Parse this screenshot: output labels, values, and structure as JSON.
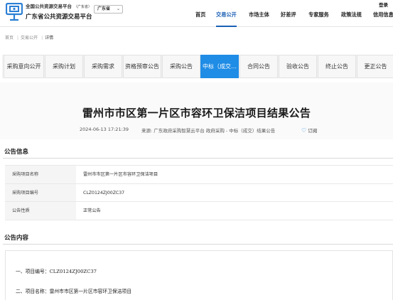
{
  "header": {
    "site_sub": "全国公共资源交易平台",
    "site_sub_note": "（广东省）",
    "site_main": "广东省公共资源交易平台",
    "region_select": "广东省",
    "login_label": "登录",
    "nav": [
      "首页",
      "交易公开",
      "市场主体",
      "好差评",
      "专家服务",
      "政策法规",
      "信用信息"
    ],
    "nav_active": "交易公开"
  },
  "breadcrumb": {
    "items": [
      "首页",
      "交易公开",
      "详情"
    ],
    "separator": "|"
  },
  "tabs": [
    "采购意向公开",
    "采购计划",
    "采购需求",
    "资格预审公告",
    "采购公告",
    "中标（成交…",
    "合同公告",
    "验收公告",
    "终止公告",
    "更正公告"
  ],
  "tab_active": "中标（成交…",
  "notice": {
    "title": "雷州市市区第一片区市容环卫保洁项目结果公告",
    "datetime": "2024-06-13 17:21:39",
    "source": "来源: 广东政府采购智慧云平台 政府采购 - 中标（成交）结果公告",
    "subscribe": "订阅"
  },
  "info_section": {
    "title": "公告信息",
    "rows": [
      {
        "key": "采购项目名称",
        "value": "雷州市市区第一片区市容环卫保洁项目"
      },
      {
        "key": "采购项目编号",
        "value": "CLZ0124ZJ00ZC37"
      },
      {
        "key": "公告性质",
        "value": "正常公告"
      }
    ]
  },
  "content_section": {
    "title": "公告内容",
    "paragraphs": [
      "一、项目编号：CLZ0124ZJ00ZC37",
      "二、项目名称：雷州市市区第一片区市容环卫保洁项目"
    ]
  },
  "colors": {
    "accent": "#1f8ce6",
    "nav_active": "#1a5fb4"
  },
  "icons": {
    "logo": "gov-trading-logo-icon",
    "subscribe": "heart-icon",
    "region": "chevron-down-icon"
  }
}
